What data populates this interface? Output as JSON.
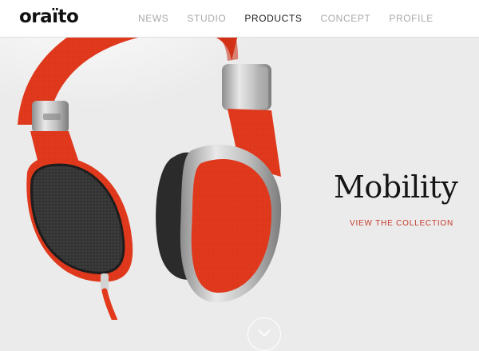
{
  "brand": {
    "logo_text": "oraïto"
  },
  "nav": {
    "items": [
      {
        "label": "NEWS"
      },
      {
        "label": "STUDIO"
      },
      {
        "label": "PRODUCTS"
      },
      {
        "label": "CONCEPT"
      },
      {
        "label": "PROFILE"
      }
    ]
  },
  "hero": {
    "title": "Mobility",
    "cta_label": "VIEW THE COLLECTION",
    "scroll_icon": "chevron-down-icon"
  },
  "colors": {
    "accent": "#c43a2a",
    "product_red": "#e2381c",
    "background": "#ebebeb",
    "nav_inactive": "#a9a9a9",
    "nav_active": "#222222"
  }
}
